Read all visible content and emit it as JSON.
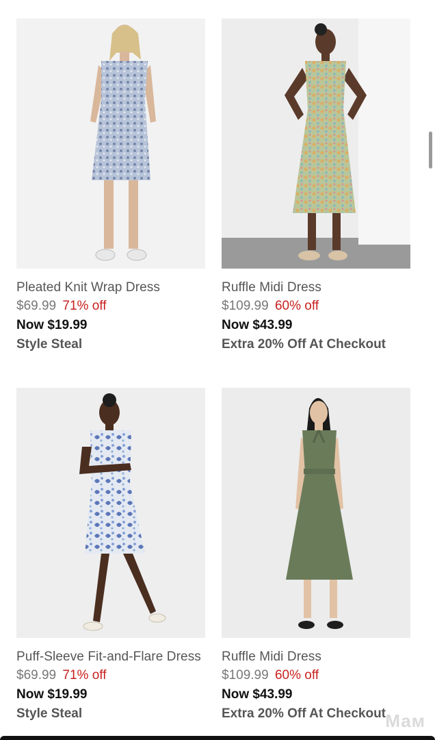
{
  "products": [
    {
      "name": "Pleated Knit Wrap Dress",
      "original_price": "$69.99",
      "discount": "71% off",
      "now_price": "Now $19.99",
      "promo": "Style Steal",
      "image_icon": "dress-photo-blue-floral-wrap",
      "dress_color": "#b7c3d8"
    },
    {
      "name": "Ruffle Midi Dress",
      "original_price": "$109.99",
      "discount": "60% off",
      "now_price": "Now $43.99",
      "promo": "Extra 20% Off At Checkout",
      "image_icon": "dress-photo-multicolor-floral-midi",
      "dress_color": "#b9c69a"
    },
    {
      "name": "Puff-Sleeve Fit-and-Flare Dress",
      "original_price": "$69.99",
      "discount": "71% off",
      "now_price": "Now $19.99",
      "promo": "Style Steal",
      "image_icon": "dress-photo-white-blue-floral",
      "dress_color": "#e4e9f2"
    },
    {
      "name": "Ruffle Midi Dress",
      "original_price": "$109.99",
      "discount": "60% off",
      "now_price": "Now $43.99",
      "promo": "Extra 20% Off At Checkout",
      "image_icon": "dress-photo-olive-green-midi",
      "dress_color": "#6a7b5a"
    }
  ],
  "watermark": "Мам",
  "colors": {
    "discount": "#c8201e",
    "photo_bg": "#f0f0f0"
  }
}
